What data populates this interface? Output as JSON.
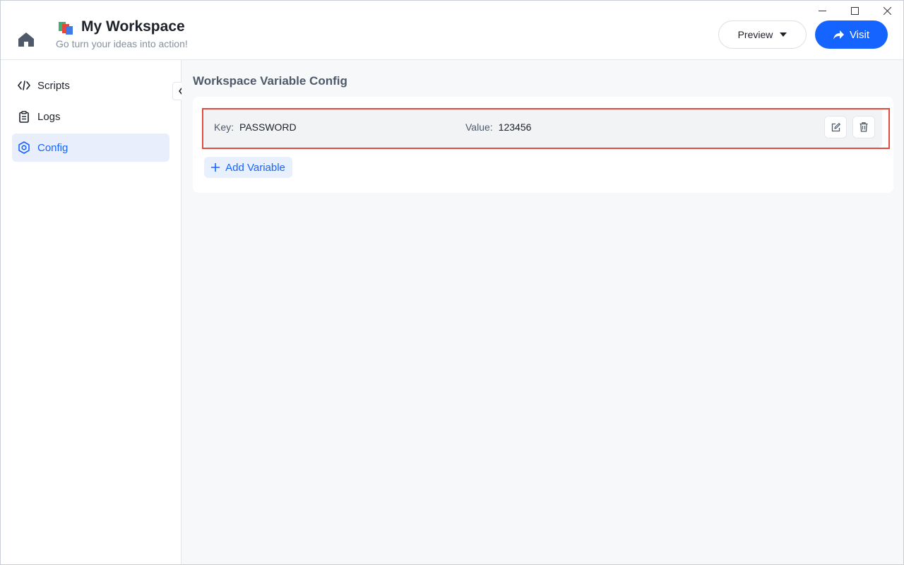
{
  "app": {
    "title": "My Workspace",
    "subtitle": "Go turn your ideas into action!"
  },
  "header": {
    "preview_label": "Preview",
    "visit_label": "Visit"
  },
  "sidebar": {
    "items": [
      {
        "label": "Scripts",
        "icon": "code-icon",
        "active": false
      },
      {
        "label": "Logs",
        "icon": "clipboard-icon",
        "active": false
      },
      {
        "label": "Config",
        "icon": "hexagon-gear-icon",
        "active": true
      }
    ]
  },
  "main": {
    "section_title": "Workspace Variable Config",
    "variables": [
      {
        "key_label": "Key:",
        "key": "PASSWORD",
        "value_label": "Value:",
        "value": "123456"
      }
    ],
    "add_variable_label": "Add Variable"
  },
  "colors": {
    "accent": "#1664ff",
    "active_bg": "#e8eefc",
    "highlight": "#e04a3f"
  }
}
